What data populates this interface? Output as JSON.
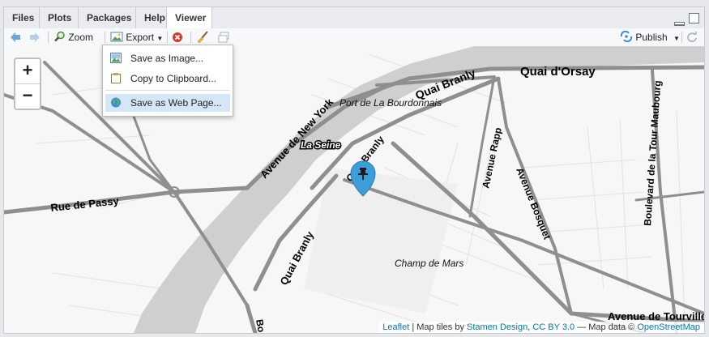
{
  "tabs": [
    {
      "label": "Files",
      "active": false
    },
    {
      "label": "Plots",
      "active": false
    },
    {
      "label": "Packages",
      "active": false
    },
    {
      "label": "Help",
      "active": false
    },
    {
      "label": "Viewer",
      "active": true
    }
  ],
  "toolbar": {
    "zoom_label": "Zoom",
    "export_label": "Export",
    "publish_label": "Publish"
  },
  "export_menu": {
    "items": [
      {
        "label": "Save as Image...",
        "icon": "image-icon"
      },
      {
        "label": "Copy to Clipboard...",
        "icon": "clipboard-icon"
      },
      {
        "label": "Save as Web Page...",
        "icon": "globe-icon",
        "highlighted": true
      }
    ]
  },
  "map": {
    "zoom_in_label": "+",
    "zoom_out_label": "−",
    "labels": {
      "quai_orsay": "Quai d'Orsay",
      "quai_branly_1": "Quai Branly",
      "quai_branly_2": "Quai Branly",
      "quai_branly_3": "Quai Branly",
      "avenue_new_york": "Avenue de New York",
      "port_bourdonnais": "Port de La Bourdonnais",
      "la_seine": "La Seine",
      "rue_passy": "Rue de Passy",
      "avenue_rapp": "Avenue Rapp",
      "avenue_bosquet": "Avenue Bosquet",
      "boulevard_maubourg": "Boulevard de la Tour Maubourg",
      "champ_de_mars": "Champ de Mars",
      "avenue_tourville": "Avenue de Tourville",
      "bottom_partial": "Bo"
    },
    "marker_color": "#3b9ed8"
  },
  "attribution": {
    "leaflet": "Leaflet",
    "sep1": " | Map tiles by ",
    "stamen": "Stamen Design",
    "comma": ", ",
    "ccby": "CC BY 3.0",
    "mid": " — Map data © ",
    "osm": "OpenStreetMap"
  }
}
